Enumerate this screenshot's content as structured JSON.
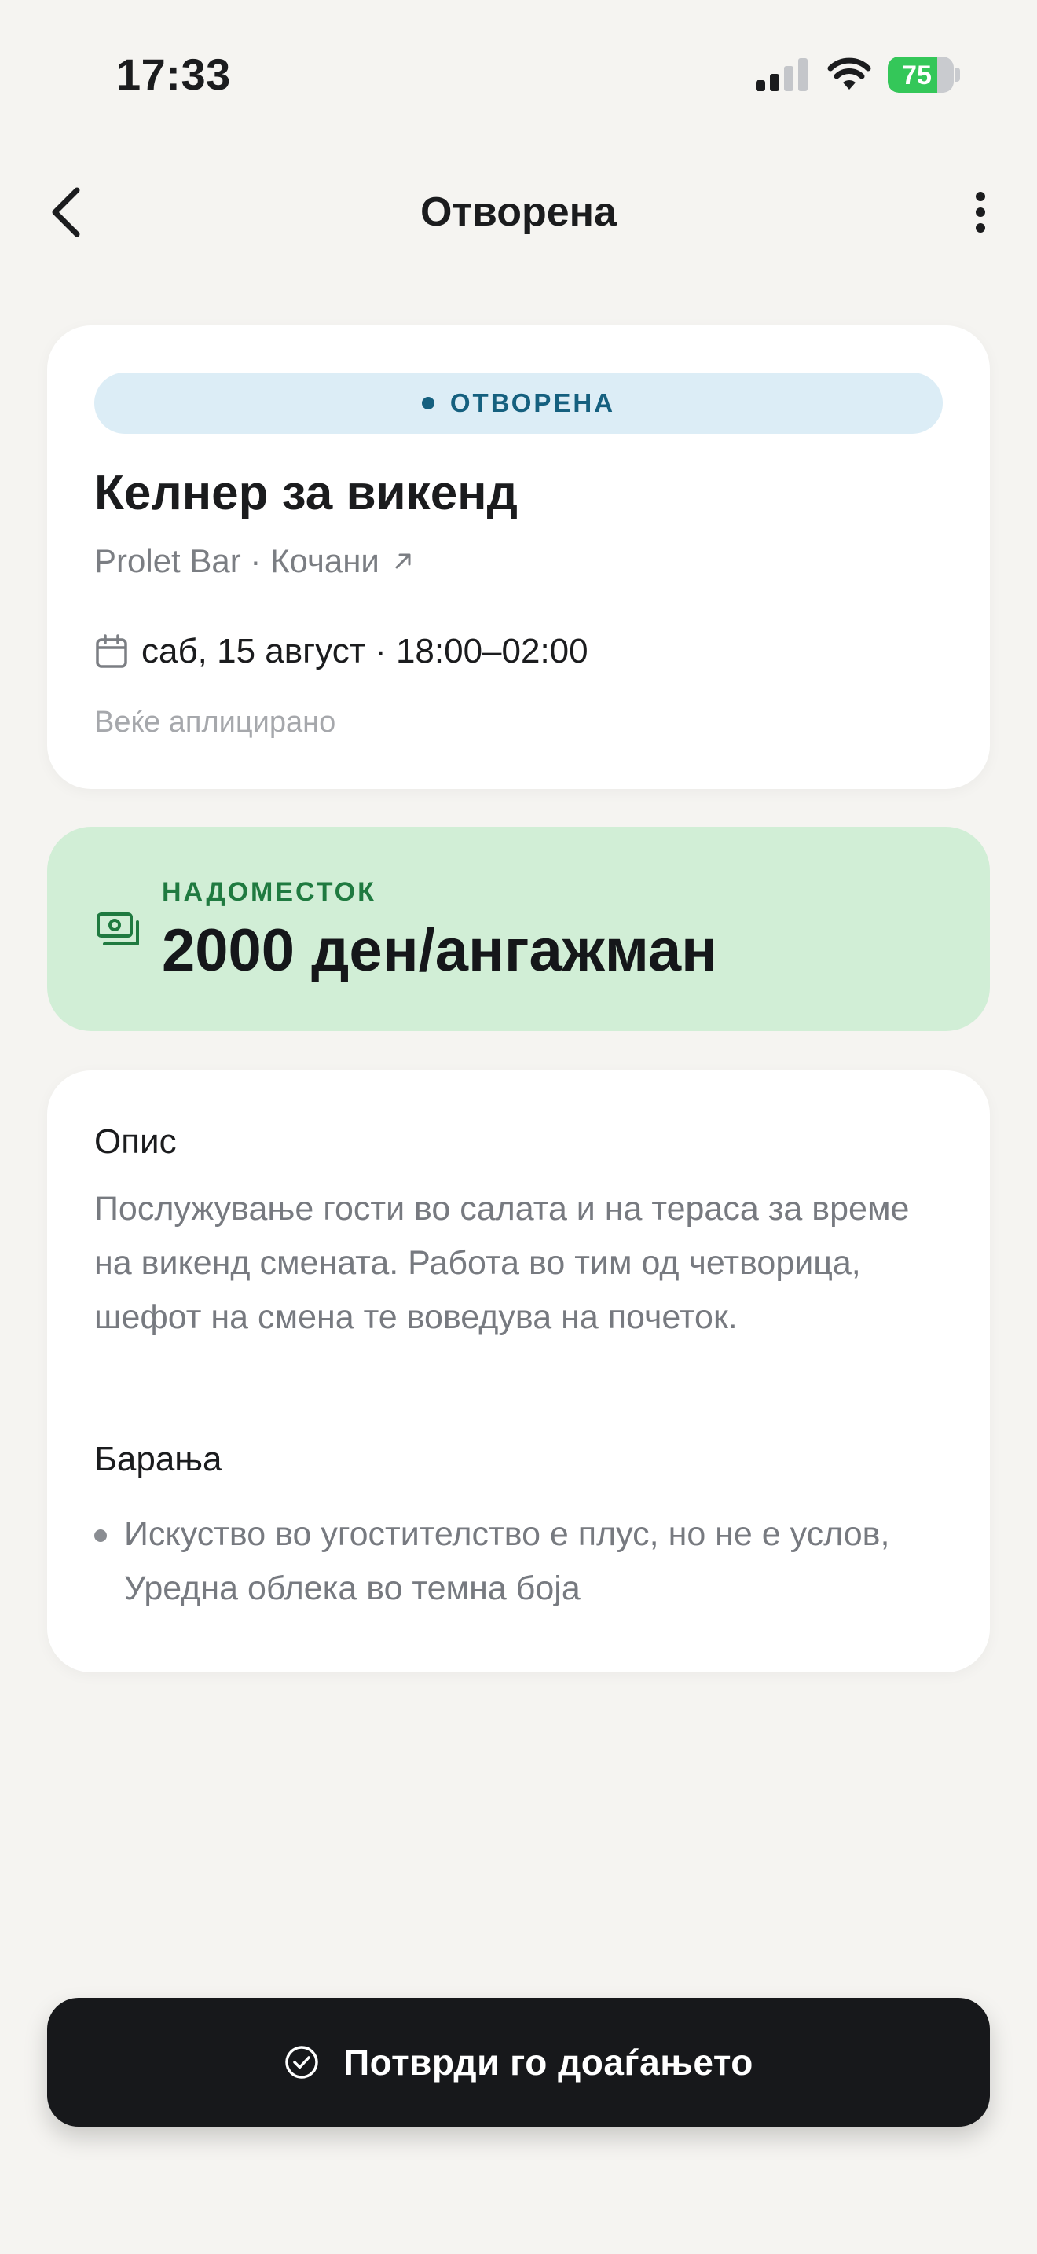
{
  "status_bar": {
    "time": "17:33",
    "battery_level": "75",
    "battery_fraction": 0.75,
    "charging": true
  },
  "nav": {
    "title": "Отворена",
    "back_icon": "chevron-left-icon",
    "more_icon": "more-vertical-icon"
  },
  "job": {
    "status_badge": "ОТВОРЕНА",
    "title": "Келнер за викенд",
    "venue": "Prolet Bar · Кочани",
    "date_time": "саб, 15 август · 18:00–02:00",
    "applied_note": "Веќе аплицирано"
  },
  "compensation": {
    "label": "НАДОМЕСТОК",
    "amount": "2000 ден/ангажман"
  },
  "details": {
    "description_title": "Опис",
    "description": "Послужување гости во салата и на тераса за време на викенд смената. Работа во тим од четворица, шефот на смена те воведува на почеток.",
    "requirements_title": "Барања",
    "requirements": [
      "Искуство во угостителство е плус, но не е услов, Уредна облека во темна боја"
    ]
  },
  "actions": {
    "confirm_label": "Потврди го доаѓањето"
  },
  "colors": {
    "background": "#f5f4f1",
    "badge_bg": "#dcedf6",
    "badge_text": "#15607f",
    "pay_bg": "#d1eed6",
    "pay_accent": "#1f7a40",
    "button_bg": "#17181b",
    "battery_green": "#34c759"
  }
}
